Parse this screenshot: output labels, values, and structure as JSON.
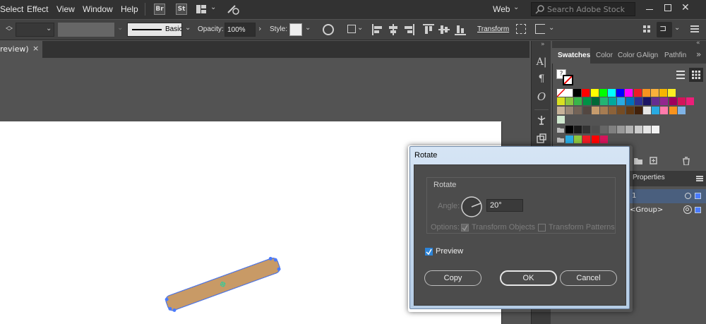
{
  "menubar": {
    "items": [
      "Select",
      "Effect",
      "View",
      "Window",
      "Help"
    ],
    "badges": [
      "Br",
      "St"
    ],
    "workspace": "Web",
    "search_placeholder": "Search Adobe Stock"
  },
  "controlbar": {
    "stroke_style_label": "Basic",
    "opacity_label": "Opacity:",
    "opacity_value": "100%",
    "style_label": "Style:",
    "transform_label": "Transform"
  },
  "document_tab": {
    "label": "review)",
    "close": "×"
  },
  "panels": {
    "tabs": [
      "Swatches",
      "Color",
      "Color G",
      "Align",
      "Pathfin"
    ],
    "layers_tab": "Properties",
    "layer_rows": [
      "1",
      "<Group>"
    ]
  },
  "tools": {
    "glyphs": [
      "A|",
      "¶",
      "O"
    ]
  },
  "colors": {
    "selection_blue": "#4a7bff",
    "object_fill": "#c89a66",
    "dialog_title_gradient": "#d6e5f5",
    "checkbox_blue": "#2d84d8"
  },
  "dialog": {
    "title": "Rotate",
    "group_label": "Rotate",
    "angle_label": "Angle:",
    "angle_value": "20°",
    "options_label": "Options:",
    "transform_objects": "Transform Objects",
    "transform_patterns": "Transform Patterns",
    "preview_label": "Preview",
    "preview_checked": true,
    "copy_button": "Copy",
    "ok_button": "OK",
    "cancel_button": "Cancel"
  }
}
